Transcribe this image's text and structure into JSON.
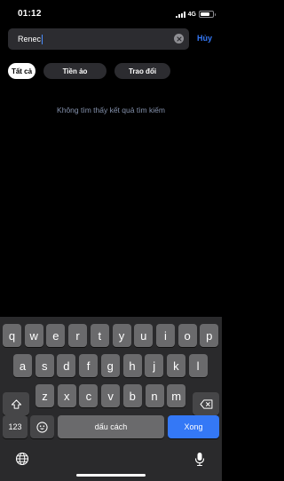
{
  "status": {
    "time": "01:12",
    "network": "4G",
    "battery_level": 0.8
  },
  "search": {
    "value": "Renec",
    "cancel_label": "Hủy"
  },
  "filters": [
    {
      "label": "Tất cả",
      "active": true
    },
    {
      "label": "Tiền ảo",
      "active": false
    },
    {
      "label": "Trao đổi",
      "active": false
    }
  ],
  "empty_message": "Không tìm thấy kết quả tìm kiếm",
  "keyboard": {
    "row1": [
      "q",
      "w",
      "e",
      "r",
      "t",
      "y",
      "u",
      "i",
      "o",
      "p"
    ],
    "row2": [
      "a",
      "s",
      "d",
      "f",
      "g",
      "h",
      "j",
      "k",
      "l"
    ],
    "row3": [
      "z",
      "x",
      "c",
      "v",
      "b",
      "n",
      "m"
    ],
    "numbers_label": "123",
    "space_label": "dấu cách",
    "done_label": "Xong",
    "icons": {
      "shift": "shift-icon",
      "backspace": "backspace-icon",
      "emoji": "emoji-icon",
      "globe": "globe-icon",
      "mic": "microphone-icon"
    }
  }
}
